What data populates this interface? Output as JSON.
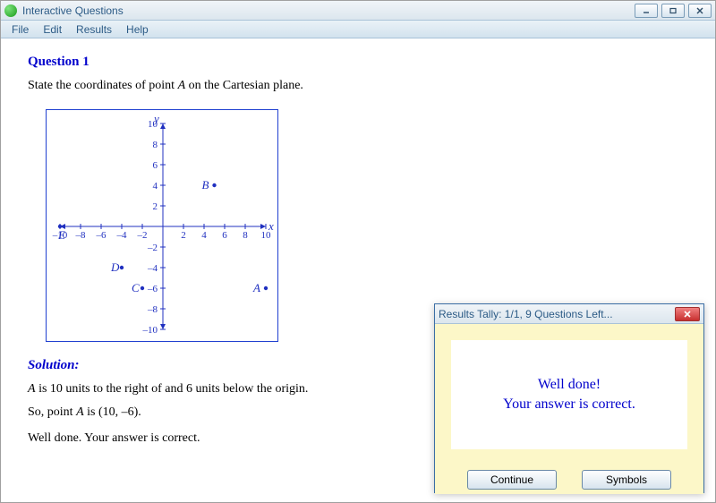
{
  "window": {
    "title": "Interactive Questions"
  },
  "menu": {
    "file": "File",
    "edit": "Edit",
    "results": "Results",
    "help": "Help"
  },
  "question": {
    "heading": "Question 1",
    "prompt_pre": "State the coordinates of point ",
    "prompt_ptA": "A",
    "prompt_post": " on the Cartesian plane."
  },
  "chart_data": {
    "type": "scatter",
    "xlabel": "x",
    "ylabel": "y",
    "xlim": [
      -10,
      10
    ],
    "ylim": [
      -10,
      10
    ],
    "xticks": [
      -10,
      -8,
      -6,
      -4,
      -2,
      2,
      4,
      6,
      8,
      10
    ],
    "yticks": [
      -10,
      -8,
      -6,
      -4,
      -2,
      2,
      4,
      6,
      8,
      10
    ],
    "points": [
      {
        "name": "A",
        "x": 10,
        "y": -6
      },
      {
        "name": "B",
        "x": 5,
        "y": 4
      },
      {
        "name": "C",
        "x": -2,
        "y": -6
      },
      {
        "name": "D",
        "x": -4,
        "y": -4
      },
      {
        "name": "E",
        "x": -10,
        "y": 0
      }
    ]
  },
  "solution": {
    "heading": "Solution:",
    "line1_pre": "A",
    "line1_mid": " is 10 units to the right of and 6 units below the origin.",
    "line2_pre": "So, point ",
    "line2_ptA": "A",
    "line2_post": " is (10, –6).",
    "line3": "Well done.  Your answer is correct."
  },
  "tally": {
    "title": "Results Tally: 1/1, 9 Questions Left...",
    "msg1": "Well done!",
    "msg2": "Your answer is correct.",
    "continue_label": "Continue",
    "symbols_label": "Symbols"
  }
}
